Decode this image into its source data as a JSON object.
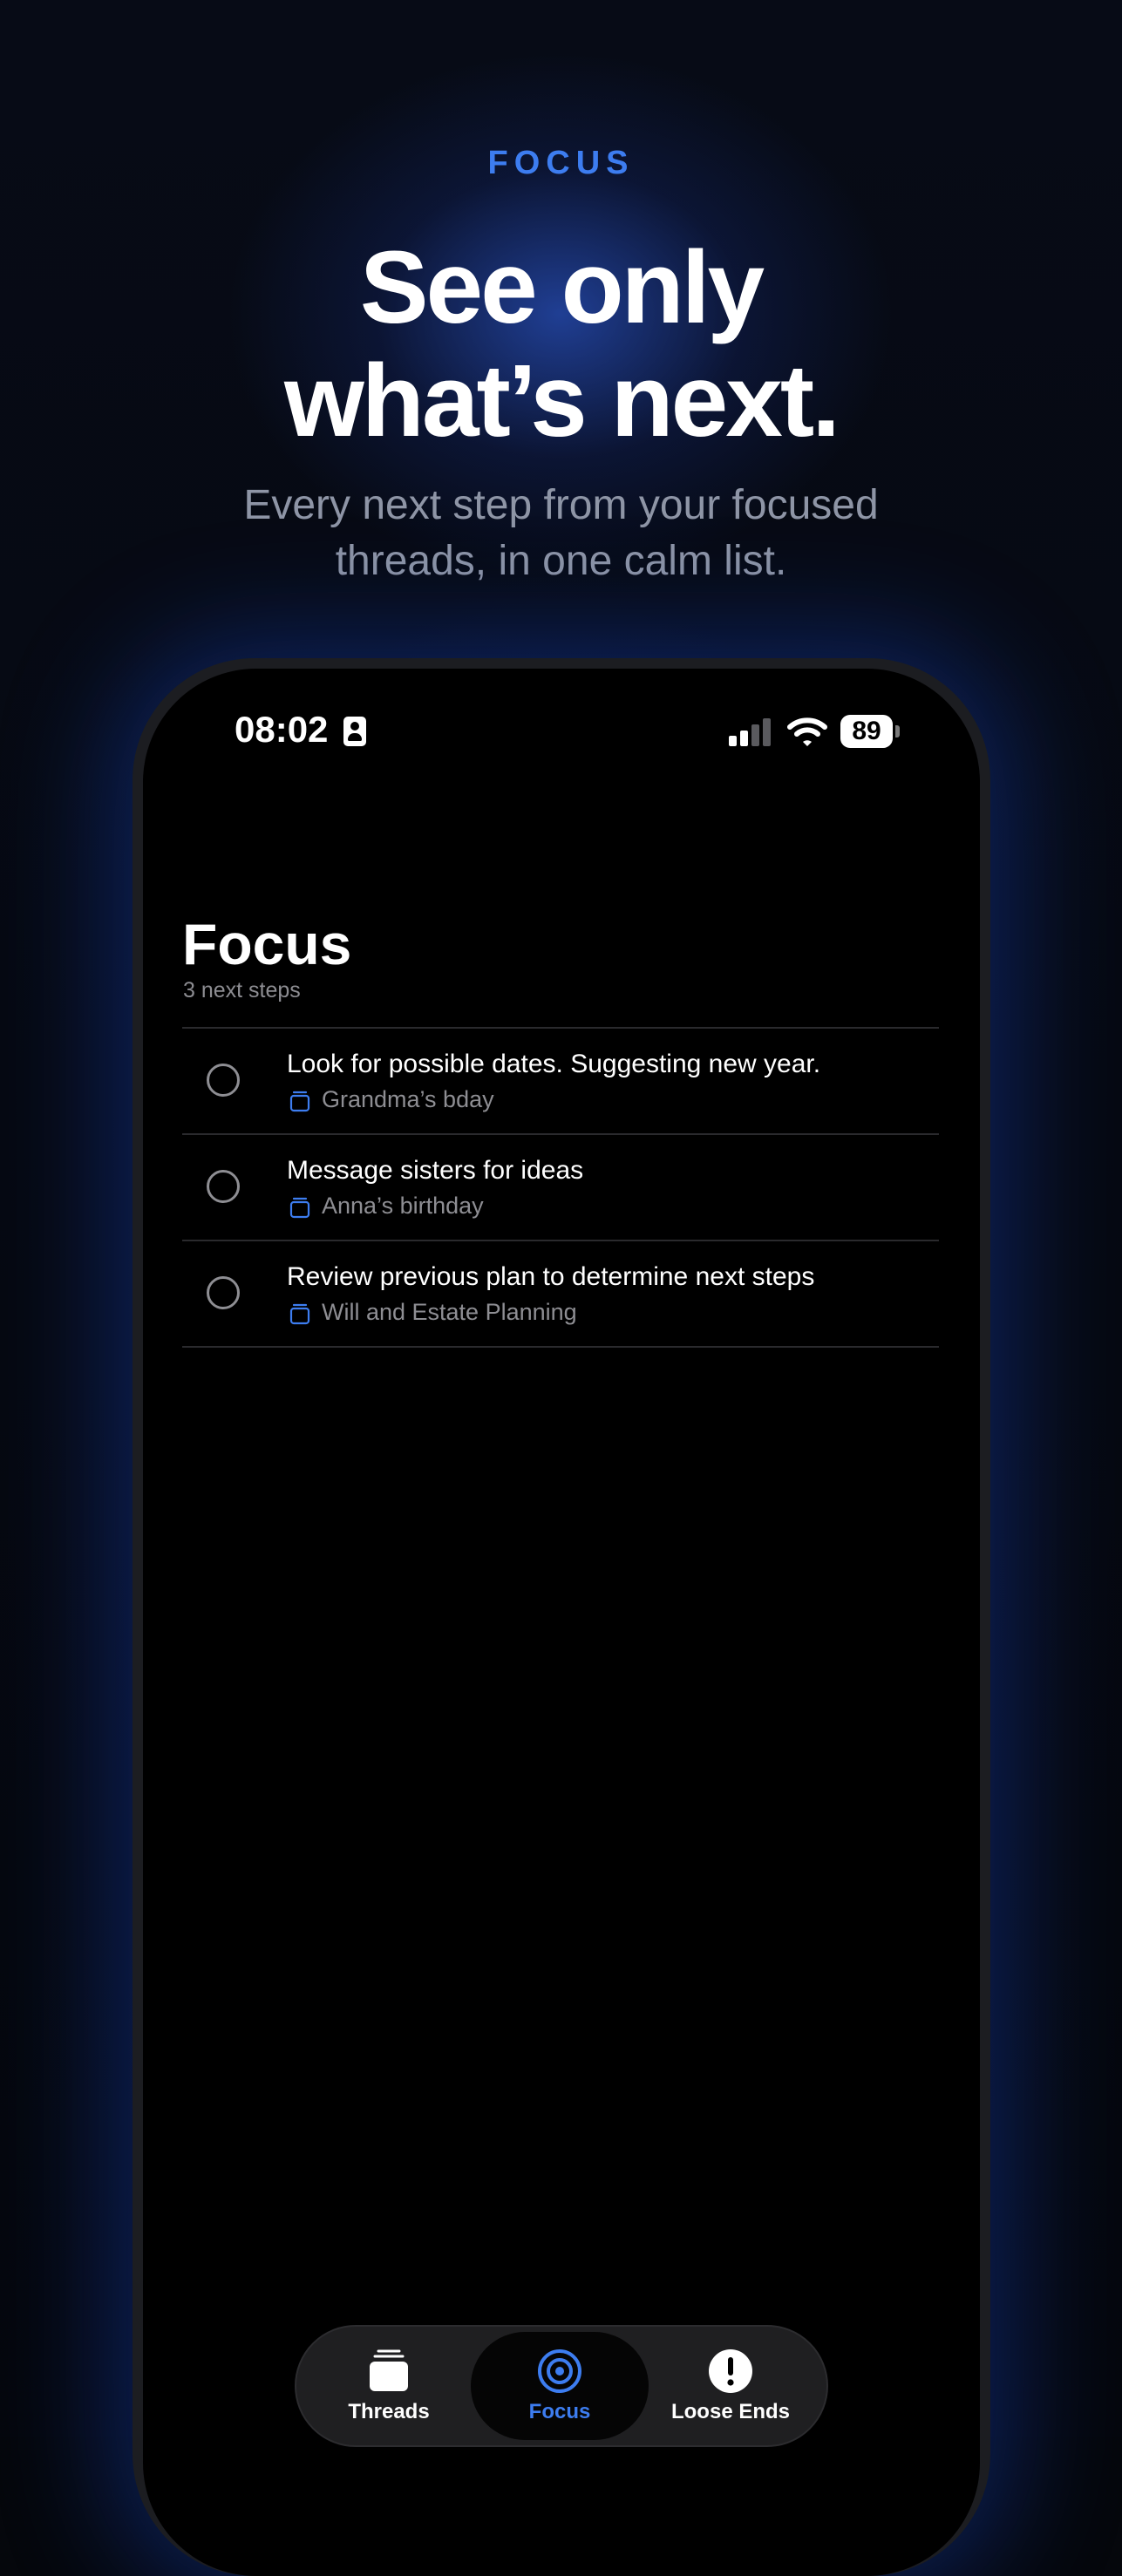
{
  "promo": {
    "eyebrow": "FOCUS",
    "headline_line1": "See only",
    "headline_line2": "what’s next.",
    "subhead_line1": "Every next step from your focused",
    "subhead_line2": "threads, in one calm list."
  },
  "status_bar": {
    "time": "08:02",
    "battery": "89",
    "signal_bars_active": 2,
    "signal_bars_total": 4
  },
  "screen": {
    "title": "Focus",
    "count": "3 next steps",
    "steps": [
      {
        "text": "Look for possible dates. Suggesting new year.",
        "thread": "Grandma’s bday",
        "done": false
      },
      {
        "text": "Message sisters for ideas",
        "thread": "Anna’s birthday",
        "done": false
      },
      {
        "text": "Review previous plan to determine next steps",
        "thread": "Will and Estate Planning",
        "done": false
      }
    ]
  },
  "tab_bar": {
    "tabs": [
      {
        "label": "Threads",
        "icon": "threads-stack-icon",
        "active": false
      },
      {
        "label": "Focus",
        "icon": "focus-target-icon",
        "active": true
      },
      {
        "label": "Loose Ends",
        "icon": "exclamation-circle-icon",
        "active": false
      }
    ]
  },
  "colors": {
    "accent": "#3d7df0",
    "background": "#05070c",
    "secondary_text": "#8e8e93"
  }
}
